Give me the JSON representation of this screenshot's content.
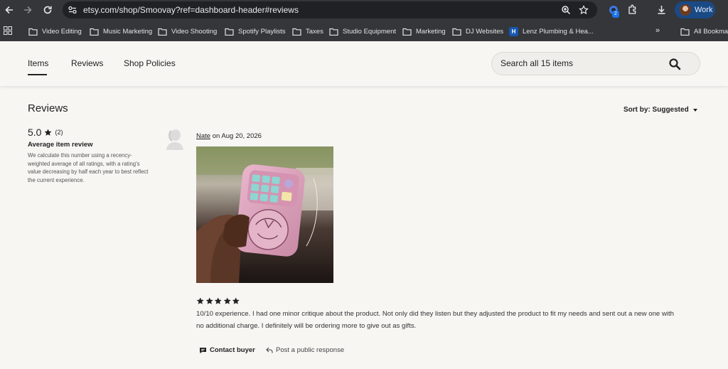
{
  "browser": {
    "url": "etsy.com/shop/Smoovay?ref=dashboard-header#reviews",
    "extension_badge": "2",
    "profile_label": "Work",
    "bookmarks": [
      {
        "label": "Video Editing",
        "icon": "folder-icon"
      },
      {
        "label": "Music Marketing",
        "icon": "folder-icon"
      },
      {
        "label": "Video Shooting",
        "icon": "folder-icon"
      },
      {
        "label": "Spotify Playlists",
        "icon": "folder-icon"
      },
      {
        "label": "Taxes",
        "icon": "folder-icon"
      },
      {
        "label": "Studio Equipment",
        "icon": "folder-icon"
      },
      {
        "label": "Marketing",
        "icon": "folder-icon"
      },
      {
        "label": "DJ  Websites",
        "icon": "folder-icon"
      },
      {
        "label": "Lenz Plumbing & Hea...",
        "icon": "h-favicon"
      }
    ],
    "bookmarks_overflow": "»",
    "all_bookmarks": "All Bookmar",
    "favicon_letter": "H"
  },
  "shop_nav": {
    "tabs": [
      {
        "label": "Items",
        "active": true
      },
      {
        "label": "Reviews",
        "active": false
      },
      {
        "label": "Shop Policies",
        "active": false
      }
    ],
    "search_placeholder": "Search all 15 items"
  },
  "reviews": {
    "heading": "Reviews",
    "sort_label": "Sort by: Suggested",
    "average": {
      "value": "5.0",
      "count": "(2)",
      "title": "Average item review",
      "description": "We calculate this number using a recency-weighted average of all ratings, with a rating's value decreasing by half each year to best reflect the current experience."
    },
    "items": [
      {
        "reviewer": "Nate",
        "date_text": "on Aug 20, 2026",
        "rating": 5,
        "text": "10/10 experience. I had one minor critique about the product. Not only did they listen but they adjusted the product to fit my needs and sent out a new one with no additional charge. I definitely will be ordering more to give out as gifts.",
        "actions": {
          "contact": "Contact buyer",
          "respond": "Post a public response"
        }
      }
    ]
  },
  "colors": {
    "chrome_bar": "#35363a",
    "omnibox": "#202124",
    "page_bg": "#f7f6f3",
    "text": "#222222",
    "profile_chip": "#1a4a85"
  }
}
